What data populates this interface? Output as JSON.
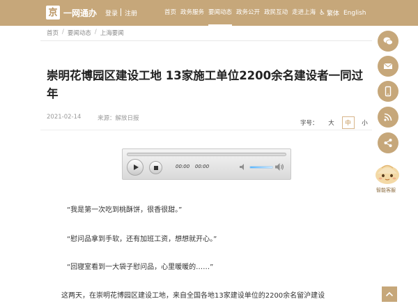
{
  "header": {
    "logo_char": "京",
    "brand": "一网通办",
    "login_label": "登录",
    "register_label": "注册",
    "nav": [
      {
        "label": "首页"
      },
      {
        "label": "政务服务"
      },
      {
        "label": "要闻动态",
        "active": true
      },
      {
        "label": "政务公开"
      },
      {
        "label": "政民互动"
      },
      {
        "label": "走进上海"
      }
    ],
    "accessibility_icon": "accessibility-icon",
    "traditional_label": "繁体",
    "english_label": "English",
    "bg_color": "#c6a77a"
  },
  "breadcrumb": {
    "items": [
      "首页",
      "要闻动态",
      "上海要闻"
    ],
    "separator": "/"
  },
  "article": {
    "title": "崇明花博园区建设工地 13家施工单位2200余名建设者一同过年",
    "date": "2021-02-14",
    "source": "来源：解放日报",
    "font_size": {
      "label": "字号：",
      "options": [
        {
          "label": "大"
        },
        {
          "label": "中",
          "active": true
        },
        {
          "label": "小"
        }
      ]
    },
    "paragraphs": [
      "“我是第一次吃到桃酥饼，很香很甜。”",
      "“慰问品拿到手软，还有加班工资，想想就开心。”",
      "“回寝室看到一大袋子慰问品，心里暖暖的……”",
      "这两天，在崇明花博园区建设工地，来自全国各地13家建设单位的2200余名留沪建设"
    ]
  },
  "audio_player": {
    "current_time": "00:00",
    "duration": "00:00",
    "progress": 0,
    "volume": 0.6
  },
  "side_bar": {
    "buttons": [
      "wechat-icon",
      "mail-icon",
      "mobile-icon",
      "rss-icon",
      "share-icon"
    ],
    "assistant_label": "智能客服",
    "back_to_top_icon": "arrow-up-icon"
  }
}
